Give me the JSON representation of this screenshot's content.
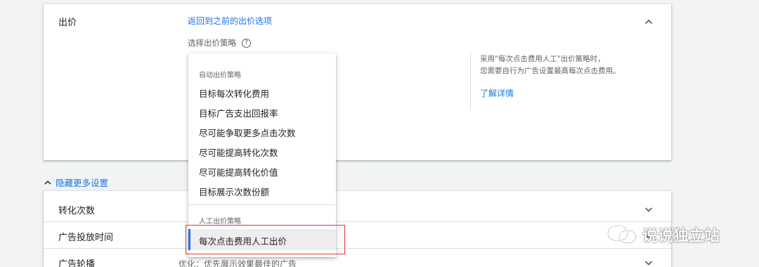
{
  "bid_card": {
    "title": "出价",
    "back_link": "返回到之前的出价选项",
    "strategy_label": "选择出价策略",
    "help_icon_glyph": "?",
    "info_text_line1": "采用\"每次点击费用人工\"出价策略时，",
    "info_text_line2": "您需要自行为广告设置最高每次点击费用。",
    "info_link": "了解详情"
  },
  "dropdown": {
    "auto_header": "自动出价策略",
    "auto_items": [
      "目标每次转化费用",
      "目标广告支出回报率",
      "尽可能争取更多点击次数",
      "尽可能提高转化次数",
      "尽可能提高转化价值",
      "目标展示次数份额"
    ],
    "manual_header": "人工出价策略",
    "selected_item": "每次点击费用人工出价"
  },
  "more_settings": {
    "toggle_label": "隐藏更多设置",
    "rows": [
      {
        "label": "转化次数"
      },
      {
        "label": "广告投放时间"
      },
      {
        "label": "广告轮播",
        "value": "优化：优先展示效果最佳的广告"
      }
    ]
  },
  "watermark": {
    "text": "说说独立站"
  },
  "colors": {
    "link": "#1a73e8",
    "highlight": "#e53935",
    "selected_bg": "#eeeeee"
  }
}
